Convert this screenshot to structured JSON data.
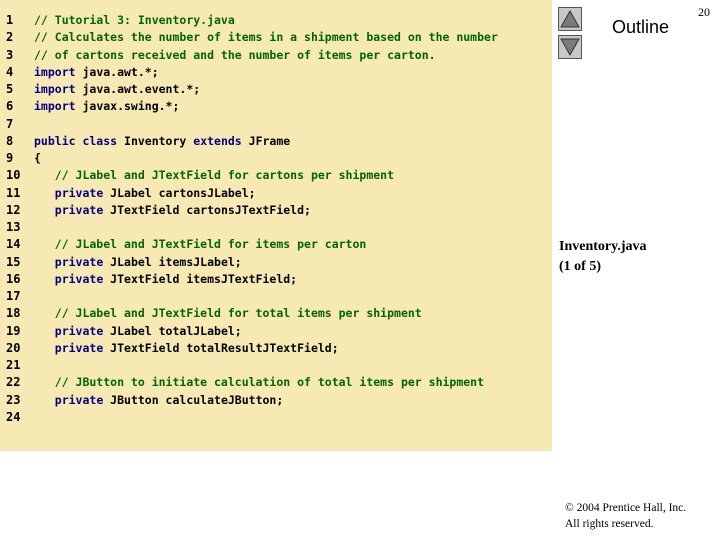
{
  "slide": {
    "page_number": "20",
    "outline_label": "Outline",
    "file_name": "Inventory.java",
    "part": "(1 of 5)",
    "copyright_line1": "© 2004 Prentice Hall, Inc.",
    "copyright_line2": "All rights reserved."
  },
  "code_lines": [
    {
      "n": "1",
      "segs": [
        {
          "t": "// Tutorial 3: Inventory.java",
          "c": "cm"
        }
      ]
    },
    {
      "n": "2",
      "segs": [
        {
          "t": "// Calculates the number of items in a shipment based on the number",
          "c": "cm"
        }
      ]
    },
    {
      "n": "3",
      "segs": [
        {
          "t": "// of cartons received and the number of items per carton.",
          "c": "cm"
        }
      ]
    },
    {
      "n": "4",
      "segs": [
        {
          "t": "import",
          "c": "kw"
        },
        {
          "t": " java.awt.*;",
          "c": ""
        }
      ]
    },
    {
      "n": "5",
      "segs": [
        {
          "t": "import",
          "c": "kw"
        },
        {
          "t": " java.awt.event.*;",
          "c": ""
        }
      ]
    },
    {
      "n": "6",
      "segs": [
        {
          "t": "import",
          "c": "kw"
        },
        {
          "t": " javax.swing.*;",
          "c": ""
        }
      ]
    },
    {
      "n": "7",
      "segs": []
    },
    {
      "n": "8",
      "segs": [
        {
          "t": "public class",
          "c": "kw"
        },
        {
          "t": " Inventory ",
          "c": ""
        },
        {
          "t": "extends",
          "c": "kw"
        },
        {
          "t": " JFrame",
          "c": ""
        }
      ]
    },
    {
      "n": "9",
      "segs": [
        {
          "t": "{",
          "c": ""
        }
      ]
    },
    {
      "n": "10",
      "segs": [
        {
          "t": "   // JLabel and JTextField for cartons per shipment",
          "c": "cm"
        }
      ]
    },
    {
      "n": "11",
      "segs": [
        {
          "t": "   ",
          "c": ""
        },
        {
          "t": "private",
          "c": "kw"
        },
        {
          "t": " JLabel cartonsJLabel;",
          "c": ""
        }
      ]
    },
    {
      "n": "12",
      "segs": [
        {
          "t": "   ",
          "c": ""
        },
        {
          "t": "private",
          "c": "kw"
        },
        {
          "t": " JTextField cartonsJTextField;",
          "c": ""
        }
      ]
    },
    {
      "n": "13",
      "segs": []
    },
    {
      "n": "14",
      "segs": [
        {
          "t": "   // JLabel and JTextField for items per carton",
          "c": "cm"
        }
      ]
    },
    {
      "n": "15",
      "segs": [
        {
          "t": "   ",
          "c": ""
        },
        {
          "t": "private",
          "c": "kw"
        },
        {
          "t": " JLabel itemsJLabel;",
          "c": ""
        }
      ]
    },
    {
      "n": "16",
      "segs": [
        {
          "t": "   ",
          "c": ""
        },
        {
          "t": "private",
          "c": "kw"
        },
        {
          "t": " JTextField itemsJTextField;",
          "c": ""
        }
      ]
    },
    {
      "n": "17",
      "segs": []
    },
    {
      "n": "18",
      "segs": [
        {
          "t": "   // JLabel and JTextField for total items per shipment",
          "c": "cm"
        }
      ]
    },
    {
      "n": "19",
      "segs": [
        {
          "t": "   ",
          "c": ""
        },
        {
          "t": "private",
          "c": "kw"
        },
        {
          "t": " JLabel totalJLabel;",
          "c": ""
        }
      ]
    },
    {
      "n": "20",
      "segs": [
        {
          "t": "   ",
          "c": ""
        },
        {
          "t": "private",
          "c": "kw"
        },
        {
          "t": " JTextField totalResultJTextField;",
          "c": ""
        }
      ]
    },
    {
      "n": "21",
      "segs": []
    },
    {
      "n": "22",
      "segs": [
        {
          "t": "   // JButton to initiate calculation of total items per shipment",
          "c": "cm"
        }
      ]
    },
    {
      "n": "23",
      "segs": [
        {
          "t": "   ",
          "c": ""
        },
        {
          "t": "private",
          "c": "kw"
        },
        {
          "t": " JButton calculateJButton;",
          "c": ""
        }
      ]
    },
    {
      "n": "24",
      "segs": []
    }
  ],
  "icons": {
    "prev": "triangle-up-icon",
    "next": "triangle-down-icon"
  },
  "colors": {
    "code_background": "#f7e9b4",
    "keyword": "#000080",
    "comment": "#006600"
  }
}
